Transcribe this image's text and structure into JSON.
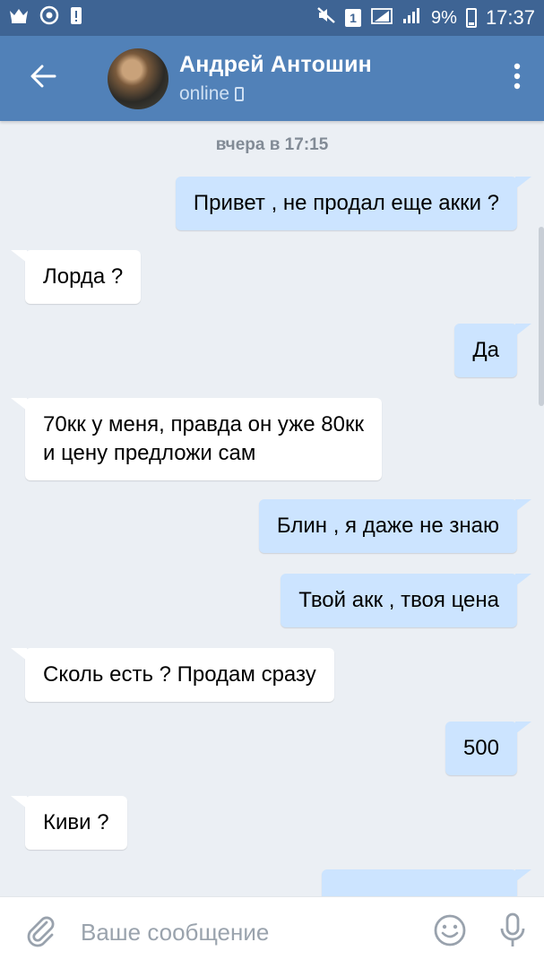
{
  "status_bar": {
    "time": "17:37",
    "battery": "9%",
    "sim_badge": "1",
    "icons": [
      "crown-icon",
      "vk-icon",
      "alert-icon",
      "mute-icon",
      "signal-icon",
      "wifi-icon"
    ]
  },
  "header": {
    "name": "Андрей Антошин",
    "status": "online",
    "status_icon": "phone-icon"
  },
  "chat": {
    "date": "вчера в 17:15",
    "messages": [
      {
        "dir": "out",
        "text": "Привет , не продал еще акки ?"
      },
      {
        "dir": "in",
        "text": "Лорда ?"
      },
      {
        "dir": "out",
        "text": "Да"
      },
      {
        "dir": "in",
        "text": "70кк у меня, правда он уже 80кк\nи цену предложи сам"
      },
      {
        "dir": "out",
        "text": "Блин ,  я даже не знаю"
      },
      {
        "dir": "out",
        "text": "Твой акк , твоя цена"
      },
      {
        "dir": "in",
        "text": "Сколь есть ? Продам сразу"
      },
      {
        "dir": "out",
        "text": "500"
      },
      {
        "dir": "in",
        "text": "Киви ?"
      }
    ]
  },
  "input": {
    "placeholder": "Ваше сообщение"
  },
  "colors": {
    "status_bar": "#3e6494",
    "header": "#5181b8",
    "background": "#ebeff4",
    "outgoing_bubble": "#cce4ff",
    "incoming_bubble": "#ffffff",
    "icon_gray": "#99a2ad"
  }
}
